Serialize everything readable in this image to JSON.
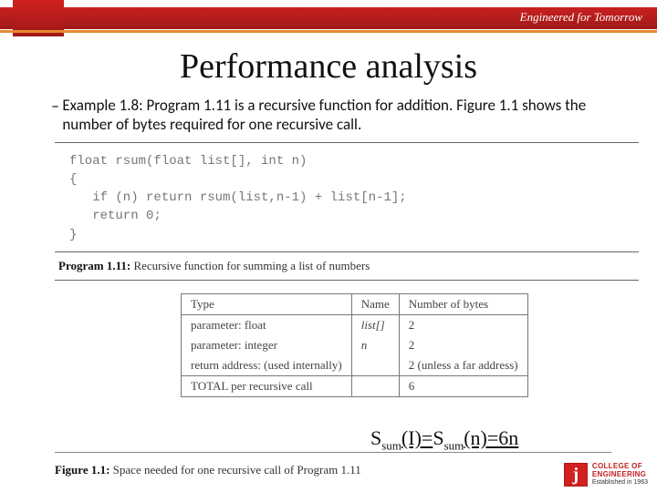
{
  "header": {
    "tagline": "Engineered for Tomorrow"
  },
  "title": "Performance analysis",
  "bullet": "Example 1.8: Program 1.11 is a recursive function for addition. Figure 1.1 shows the number of bytes required for one recursive call.",
  "program": {
    "code": "float rsum(float list[], int n)\n{\n   if (n) return rsum(list,n-1) + list[n-1];\n   return 0;\n}",
    "caption_num": "Program 1.11:",
    "caption_text": " Recursive function for summing a list of numbers"
  },
  "table": {
    "headers": [
      "Type",
      "Name",
      "Number of bytes"
    ],
    "rows": [
      [
        "parameter: float",
        "list[]",
        "2"
      ],
      [
        "parameter: integer",
        "n",
        "2"
      ],
      [
        "return address: (used internally)",
        "",
        "2 (unless a far address)"
      ],
      [
        "TOTAL per recursive call",
        "",
        "6"
      ]
    ]
  },
  "formula": {
    "s": "S",
    "sub": "sum",
    "arg1": "(I)=",
    "arg2": "(n)=6n"
  },
  "figure": {
    "num": "Figure 1.1:",
    "text": " Space needed for one recursive call of Program 1.11"
  },
  "footer": {
    "logo_letter": "j",
    "line1": "COLLEGE OF",
    "line2": "ENGINEERING",
    "line3": "Established in 1963"
  }
}
